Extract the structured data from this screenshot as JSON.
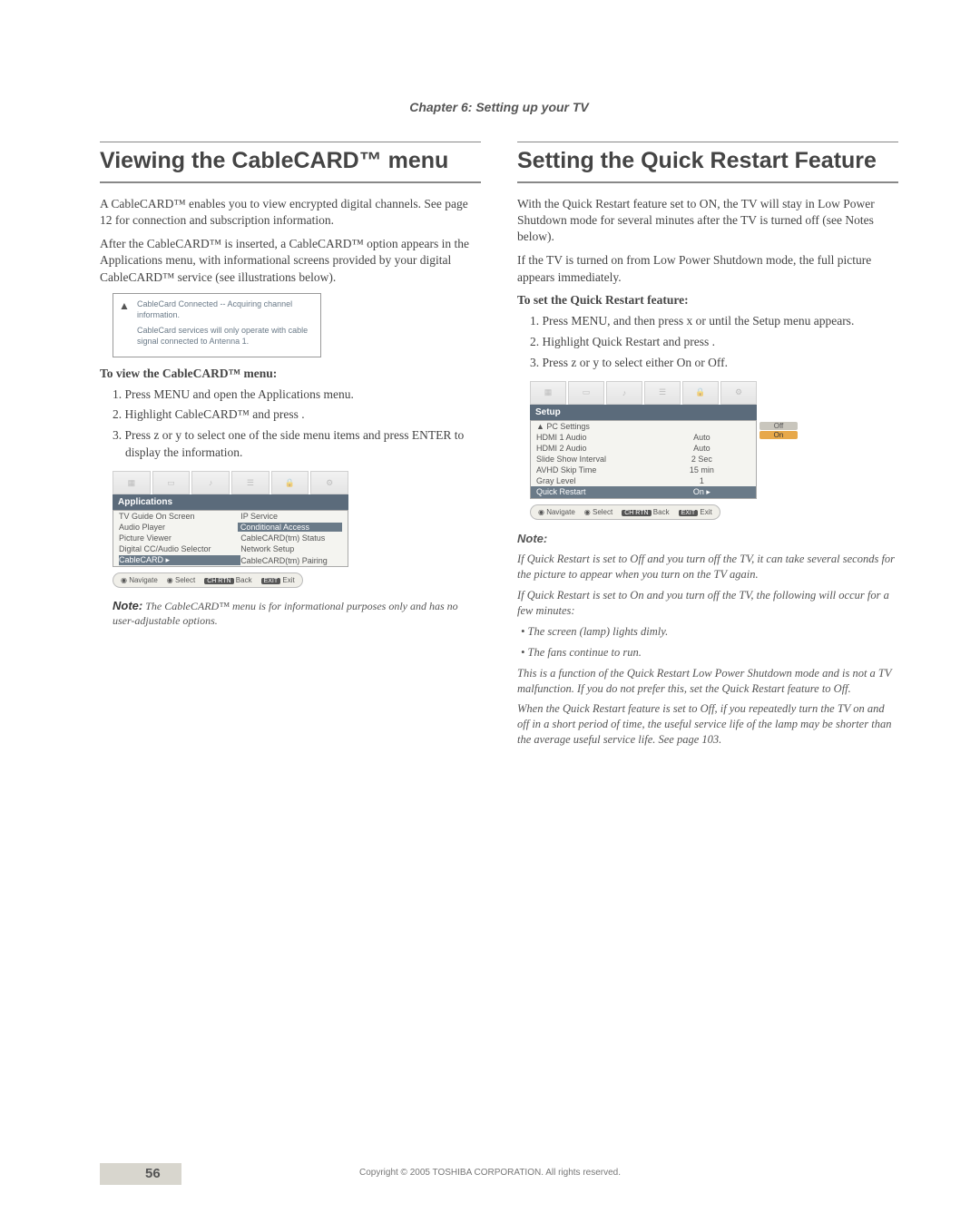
{
  "chapter": "Chapter 6: Setting up your TV",
  "left": {
    "title": "Viewing the CableCARD™ menu",
    "p1": "A CableCARD™ enables you to view encrypted digital channels. See page 12 for connection and subscription information.",
    "p2": "After the CableCARD™ is inserted, a CableCARD™ option appears in the Applications menu, with informational screens provided by your digital CableCARD™ service (see illustrations below).",
    "shot1_line1": "CableCard Connected -- Acquiring channel information.",
    "shot1_line2": "CableCard services will only operate with cable signal connected to Antenna 1.",
    "subhead": "To view the CableCARD™ menu:",
    "step1": "1. Press MENU and open the Applications menu.",
    "step2": "2. Highlight CableCARD™ and press  .",
    "step3": "3. Press z or y to select one of the side menu items and press ENTER to display the information.",
    "apps_title": "Applications",
    "apps_rows": [
      {
        "l": "TV Guide On Screen",
        "r": "IP Service"
      },
      {
        "l": "Audio Player",
        "r": "Conditional Access",
        "rhl": true
      },
      {
        "l": "Picture Viewer",
        "r": "CableCARD(tm) Status"
      },
      {
        "l": "Digital CC/Audio Selector",
        "r": "Network Setup"
      },
      {
        "l": "CableCARD",
        "r": "CableCARD(tm) Pairing",
        "lsel": true
      }
    ],
    "footer_items": [
      "Navigate",
      "Select",
      "Back",
      "Exit"
    ],
    "note_label": "Note:",
    "note_text": " The CableCARD™ menu is for informational purposes only and has no user-adjustable options."
  },
  "right": {
    "title": "Setting the Quick Restart Feature",
    "p1": "With the Quick Restart feature set to ON, the TV will stay in Low Power Shutdown mode for several minutes after the TV is turned off (see Notes below).",
    "p2": "If the TV is turned on from Low Power Shutdown mode, the full picture appears immediately.",
    "subhead": "To set the Quick Restart feature:",
    "step1": "1. Press MENU, and then press x or   until the Setup menu appears.",
    "step2": "2. Highlight Quick Restart and press  .",
    "step3": "3. Press z or y to select either On or Off.",
    "setup_title": "Setup",
    "setup_rows": [
      {
        "l": "PC Settings",
        "r": "",
        "opt": "Off"
      },
      {
        "l": "HDMI 1 Audio",
        "r": "Auto",
        "opt": "On",
        "optsel": true
      },
      {
        "l": "HDMI 2 Audio",
        "r": "Auto"
      },
      {
        "l": "Slide Show Interval",
        "r": "2 Sec"
      },
      {
        "l": "AVHD Skip Time",
        "r": "15 min"
      },
      {
        "l": "Gray Level",
        "r": "1"
      },
      {
        "l": "Quick Restart",
        "r": "On  ▸",
        "sel": true
      }
    ],
    "footer_items": [
      "Navigate",
      "Select",
      "Back",
      "Exit"
    ],
    "note_label": "Note:",
    "notes": [
      "If Quick Restart is set to Off and you turn off the TV, it can take several seconds for the picture to appear when you turn on the TV again.",
      "If Quick Restart is set to On and you turn off the TV, the following will occur for a few minutes:"
    ],
    "bullets": [
      "The screen (lamp) lights dimly.",
      "The fans continue to run."
    ],
    "notes2": [
      "This is a function of the Quick Restart Low Power Shutdown mode and is not a TV malfunction. If you do not prefer this, set the Quick Restart feature to Off.",
      "When the Quick Restart feature is set to Off, if you repeatedly turn the TV on and off in a short period of time, the useful service life of the lamp may be shorter than the average useful service life. See page 103."
    ]
  },
  "page_number": "56",
  "copyright": "Copyright © 2005 TOSHIBA CORPORATION. All rights reserved."
}
